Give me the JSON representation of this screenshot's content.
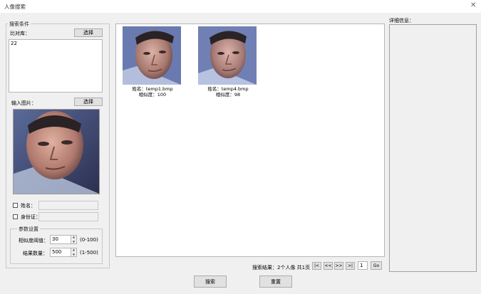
{
  "window": {
    "title": "人像搜索",
    "close_icon": "close-icon"
  },
  "search_conditions": {
    "label": "搜索条件",
    "compare_library_label": "比对库：",
    "compare_select_label": "选择",
    "compare_value": "22",
    "input_image_label": "输入图片：",
    "input_select_label": "选择",
    "name_label": "姓名：",
    "name_value": "",
    "id_label": "身份证：",
    "id_value": ""
  },
  "params": {
    "label": "参数设置",
    "similarity_label": "相似度阈值：",
    "similarity_value": "30",
    "similarity_range": "(0-100)",
    "count_label": "结果数量：",
    "count_value": "500",
    "count_range": "(1-500)"
  },
  "results": [
    {
      "name_line": "姓名：temp1.bmp",
      "score_line": "相似度：100"
    },
    {
      "name_line": "姓名：temp4.bmp",
      "score_line": "相似度：98"
    }
  ],
  "pagination": {
    "summary": "搜索结果：2个人像 共1页",
    "first": "|<",
    "prev": "<<",
    "next": ">>",
    "last": ">|",
    "page_value": "1",
    "go": "Go"
  },
  "details": {
    "label": "详细信息："
  },
  "actions": {
    "search": "搜索",
    "reset": "重置"
  }
}
